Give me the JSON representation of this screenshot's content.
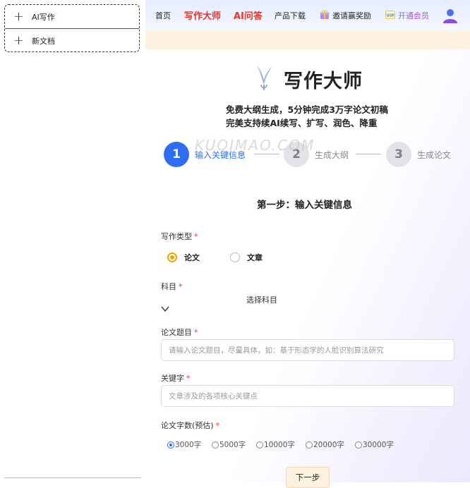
{
  "sidebar": {
    "items": [
      {
        "label": "AI写作"
      },
      {
        "label": "新文档"
      }
    ]
  },
  "nav": {
    "home": "首页",
    "writing_master": "写作大师",
    "ai_qa": "AI问答",
    "download": "产品下载",
    "invite": "邀请赢奖励",
    "vip": "开通会员"
  },
  "hero": {
    "brand": "写作大师",
    "tagline1": "免费大纲生成，5分钟完成3万字论文初稿",
    "tagline2": "完美支持续AI续写、扩写、润色、降重"
  },
  "steps": [
    {
      "number": "1",
      "label": "输入关键信息",
      "active": true
    },
    {
      "number": "2",
      "label": "生成大纲",
      "active": false
    },
    {
      "number": "3",
      "label": "生成论文",
      "active": false
    }
  ],
  "watermark": "KUQIMAO.COM",
  "form": {
    "title": "第一步：输入关键信息",
    "writing_type": {
      "label": "写作类型",
      "options": [
        "论文",
        "文章"
      ],
      "selected": "论文"
    },
    "subject": {
      "label": "科目",
      "value": "选择科目"
    },
    "topic": {
      "label": "论文题目",
      "placeholder": "请输入论文题目，尽量具体，如：基于形态学的人脸识别算法研究"
    },
    "keywords": {
      "label": "关键字",
      "placeholder": "文章涉及的各项核心关键点"
    },
    "word_count": {
      "label": "论文字数(预估)",
      "options": [
        "3000字",
        "5000字",
        "10000字",
        "20000字",
        "30000字"
      ],
      "selected": "3000字"
    },
    "required_mark": "*",
    "next_button": "下一步"
  },
  "colors": {
    "accent_blue": "#2f6cf4",
    "brand_red": "#e8372a",
    "radio_orange": "#f3a300",
    "banner": "#fdf1df"
  }
}
